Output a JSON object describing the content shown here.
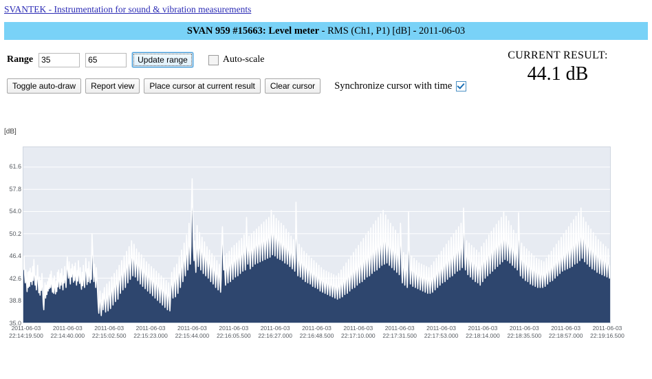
{
  "site": {
    "link_text": "SVANTEK - Instrumentation for sound & vibration measurements"
  },
  "title_banner": {
    "device": "SVAN 959 #15663: Level meter",
    "rest": " - RMS (Ch1, P1) [dB] - 2011-06-03"
  },
  "controls": {
    "range_label": "Range",
    "range_min": "35",
    "range_max": "65",
    "update_range_label": "Update range",
    "autoscale_label": "Auto-scale",
    "autoscale_checked": false,
    "toggle_autodraw_label": "Toggle auto-draw",
    "report_view_label": "Report view",
    "place_cursor_label": "Place cursor at current result",
    "clear_cursor_label": "Clear cursor",
    "sync_cursor_label": "Synchronize cursor with time",
    "sync_cursor_checked": true
  },
  "current_result": {
    "label": "CURRENT RESULT:",
    "value": "44.1 dB"
  },
  "colors": {
    "banner": "#79d2f7",
    "link": "#2b2bb5",
    "plot_background": "#e7ebf2",
    "gridline": "#ffffff",
    "series_fill": "#2e466e",
    "series_line": "#ffffff"
  },
  "chart_data": {
    "type": "area",
    "title": "SVAN 959 #15663: Level meter - RMS (Ch1, P1) [dB] - 2011-06-03",
    "xlabel": "",
    "ylabel": "[dB]",
    "unit": "[dB]",
    "grid": true,
    "legend": "none",
    "ylim": [
      35.0,
      65.0
    ],
    "yticks": [
      61.6,
      57.8,
      54.0,
      50.2,
      46.4,
      42.6,
      38.8,
      35.0
    ],
    "ytick_labels": [
      "61.6",
      "57.8",
      "54.0",
      "50.2",
      "46.4",
      "42.6",
      "38.8",
      "35.0"
    ],
    "xtick_labels": [
      [
        "2011-06-03",
        "22:14:19.500"
      ],
      [
        "2011-06-03",
        "22:14:40.000"
      ],
      [
        "2011-06-03",
        "22:15:02.500"
      ],
      [
        "2011-06-03",
        "22:15:23.000"
      ],
      [
        "2011-06-03",
        "22:15:44.000"
      ],
      [
        "2011-06-03",
        "22:16:05.500"
      ],
      [
        "2011-06-03",
        "22:16:27.000"
      ],
      [
        "2011-06-03",
        "22:16:48.500"
      ],
      [
        "2011-06-03",
        "22:17:10.000"
      ],
      [
        "2011-06-03",
        "22:17:31.500"
      ],
      [
        "2011-06-03",
        "22:17:53.000"
      ],
      [
        "2011-06-03",
        "22:18:14.000"
      ],
      [
        "2011-06-03",
        "22:18:35.500"
      ],
      [
        "2011-06-03",
        "22:18:57.000"
      ],
      [
        "2011-06-03",
        "22:19:16.500"
      ]
    ],
    "series": [
      {
        "name": "RMS (Ch1, P1) [dB]",
        "values": [
          44.0,
          46.3,
          43.2,
          41.8,
          44.0,
          42.0,
          40.3,
          43.6,
          41.0,
          43.8,
          41.2,
          44.3,
          42.0,
          43.5,
          41.5,
          44.6,
          42.2,
          45.8,
          43.1,
          41.4,
          43.0,
          40.6,
          42.4,
          44.8,
          41.9,
          40.1,
          42.8,
          39.7,
          42.2,
          40.5,
          43.4,
          41.0,
          38.4,
          37.2,
          39.6,
          41.8,
          39.2,
          41.4,
          39.8,
          42.0,
          40.4,
          42.6,
          40.8,
          43.2,
          41.0,
          43.8,
          41.6,
          40.2,
          42.4,
          40.0,
          43.0,
          41.2,
          39.9,
          42.1,
          40.3,
          43.6,
          41.1,
          44.0,
          42.2,
          40.8,
          43.4,
          41.4,
          44.2,
          42.0,
          40.6,
          43.0,
          41.8,
          44.6,
          42.4,
          41.0,
          43.8,
          46.2,
          44.0,
          42.6,
          45.4,
          43.0,
          41.6,
          44.2,
          42.8,
          45.0,
          43.4,
          41.9,
          44.6,
          42.2,
          45.2,
          43.0,
          41.4,
          43.9,
          42.1,
          45.6,
          43.2,
          41.7,
          44.4,
          42.0,
          40.7,
          43.6,
          41.3,
          44.8,
          42.5,
          41.0,
          43.2,
          46.0,
          43.8,
          41.5,
          44.2,
          42.0,
          45.4,
          43.1,
          41.8,
          44.0,
          42.4,
          50.2,
          47.6,
          44.2,
          42.0,
          45.0,
          43.2,
          41.0,
          44.4,
          42.6,
          40.2,
          38.0,
          36.6,
          38.8,
          40.4,
          37.6,
          36.2,
          38.4,
          40.0,
          37.2,
          39.4,
          41.0,
          38.2,
          36.8,
          39.0,
          41.6,
          38.8,
          37.0,
          39.8,
          42.0,
          39.2,
          37.4,
          40.0,
          42.8,
          40.2,
          38.0,
          41.0,
          43.4,
          40.6,
          38.6,
          41.4,
          44.0,
          41.2,
          39.0,
          42.0,
          44.8,
          42.2,
          40.0,
          43.0,
          45.6,
          42.8,
          40.6,
          43.6,
          46.4,
          43.2,
          41.0,
          44.0,
          47.2,
          44.2,
          41.8,
          44.6,
          48.0,
          45.0,
          42.4,
          45.4,
          49.0,
          46.0,
          43.0,
          45.8,
          48.4,
          45.2,
          42.8,
          45.0,
          47.6,
          44.6,
          42.2,
          44.8,
          47.0,
          44.0,
          41.6,
          44.2,
          46.6,
          43.8,
          41.2,
          43.6,
          46.0,
          43.0,
          40.8,
          43.2,
          45.4,
          42.6,
          40.4,
          42.8,
          45.0,
          42.2,
          40.0,
          42.4,
          44.6,
          41.8,
          39.6,
          42.0,
          44.2,
          41.4,
          39.2,
          41.6,
          43.8,
          41.0,
          38.8,
          41.2,
          43.4,
          40.6,
          38.4,
          40.8,
          43.0,
          40.2,
          38.0,
          40.4,
          42.6,
          39.8,
          37.6,
          40.0,
          42.2,
          39.4,
          37.2,
          39.6,
          41.8,
          39.0,
          37.0,
          39.2,
          41.4,
          43.6,
          41.0,
          39.2,
          42.0,
          44.4,
          41.6,
          39.4,
          42.4,
          45.0,
          42.0,
          40.0,
          43.0,
          46.2,
          43.4,
          41.0,
          44.0,
          47.4,
          44.4,
          42.0,
          45.0,
          48.6,
          45.4,
          43.0,
          46.0,
          50.0,
          46.6,
          44.0,
          47.0,
          52.0,
          48.0,
          45.0,
          48.0,
          55.0,
          59.6,
          53.0,
          48.0,
          45.6,
          49.0,
          46.0,
          43.6,
          47.0,
          51.6,
          47.4,
          44.6,
          48.0,
          50.4,
          46.8,
          44.0,
          47.2,
          49.6,
          46.2,
          43.4,
          46.4,
          48.8,
          45.6,
          43.0,
          45.8,
          48.0,
          45.0,
          42.6,
          45.2,
          47.4,
          44.4,
          42.0,
          44.6,
          46.8,
          43.8,
          41.6,
          44.0,
          46.2,
          43.2,
          41.0,
          43.4,
          45.6,
          42.6,
          40.6,
          43.0,
          45.0,
          42.0,
          40.2,
          42.6,
          49.0,
          51.4,
          47.0,
          44.0,
          46.4,
          43.4,
          41.4,
          44.2,
          46.8,
          43.8,
          41.8,
          44.6,
          47.2,
          44.2,
          42.0,
          45.0,
          47.8,
          44.6,
          42.4,
          45.4,
          48.2,
          45.0,
          42.8,
          45.8,
          48.6,
          45.4,
          43.0,
          46.0,
          49.0,
          45.8,
          43.4,
          46.4,
          49.4,
          46.2,
          43.8,
          46.8,
          50.0,
          46.6,
          44.0,
          47.0,
          53.0,
          48.0,
          45.0,
          47.4,
          49.8,
          46.4,
          44.2,
          47.2,
          50.2,
          47.0,
          44.6,
          47.6,
          50.6,
          47.4,
          45.0,
          48.0,
          51.0,
          47.8,
          45.2,
          48.2,
          51.4,
          48.0,
          45.4,
          48.4,
          51.8,
          48.2,
          45.6,
          48.6,
          52.2,
          48.4,
          45.8,
          48.8,
          52.6,
          48.6,
          46.0,
          49.0,
          53.0,
          49.2,
          46.2,
          49.4,
          54.2,
          50.0,
          46.6,
          49.8,
          53.4,
          49.6,
          46.4,
          49.2,
          52.8,
          49.0,
          46.0,
          48.8,
          52.4,
          48.6,
          45.8,
          48.4,
          52.0,
          48.2,
          45.6,
          48.0,
          51.6,
          47.8,
          45.2,
          47.6,
          51.0,
          47.4,
          45.0,
          47.2,
          50.4,
          47.0,
          44.6,
          46.8,
          49.8,
          46.4,
          44.2,
          46.4,
          49.2,
          46.0,
          43.8,
          46.0,
          55.6,
          50.0,
          45.4,
          43.0,
          45.6,
          48.4,
          45.0,
          42.8,
          45.2,
          47.8,
          44.6,
          42.4,
          44.8,
          47.2,
          44.2,
          42.0,
          44.4,
          46.8,
          43.8,
          41.8,
          44.0,
          46.4,
          43.4,
          41.6,
          43.6,
          46.0,
          43.0,
          41.2,
          43.2,
          45.6,
          42.8,
          41.0,
          43.0,
          45.2,
          42.4,
          40.8,
          42.6,
          44.8,
          42.0,
          40.4,
          42.2,
          44.4,
          41.8,
          40.2,
          42.0,
          44.0,
          41.4,
          40.0,
          41.8,
          43.8,
          41.2,
          39.8,
          41.6,
          43.6,
          41.0,
          39.6,
          41.4,
          43.4,
          41.0,
          39.4,
          41.2,
          43.2,
          40.8,
          39.2,
          41.0,
          43.0,
          40.6,
          39.0,
          41.0,
          43.4,
          40.8,
          39.2,
          41.4,
          44.0,
          41.2,
          39.4,
          41.8,
          44.6,
          41.6,
          39.8,
          42.2,
          45.2,
          42.0,
          40.0,
          42.6,
          45.8,
          42.4,
          40.4,
          43.0,
          46.4,
          42.8,
          40.8,
          43.4,
          47.0,
          43.2,
          41.0,
          43.8,
          47.6,
          43.6,
          41.4,
          44.2,
          48.2,
          44.0,
          41.8,
          44.6,
          48.8,
          44.4,
          42.0,
          45.0,
          49.4,
          44.8,
          42.4,
          45.4,
          50.0,
          45.2,
          42.8,
          45.8,
          50.6,
          45.6,
          43.0,
          46.2,
          51.2,
          46.0,
          43.4,
          46.6,
          51.8,
          46.4,
          43.8,
          47.0,
          52.4,
          46.8,
          44.0,
          47.4,
          53.0,
          47.2,
          44.4,
          47.8,
          53.6,
          47.6,
          44.8,
          48.2,
          54.2,
          48.0,
          45.0,
          48.6,
          53.4,
          47.8,
          45.2,
          48.0,
          52.6,
          47.4,
          44.8,
          47.6,
          52.0,
          47.0,
          44.4,
          47.2,
          51.4,
          46.6,
          44.0,
          46.8,
          50.8,
          46.2,
          43.6,
          46.4,
          50.2,
          45.8,
          43.2,
          46.0,
          52.0,
          49.0,
          44.0,
          41.8,
          44.4,
          47.0,
          43.8,
          41.4,
          44.0,
          46.6,
          43.4,
          41.0,
          43.6,
          54.0,
          48.0,
          44.2,
          41.6,
          44.0,
          46.4,
          43.2,
          41.2,
          43.8,
          46.0,
          43.0,
          41.0,
          43.4,
          45.6,
          42.6,
          40.8,
          43.0,
          45.2,
          42.4,
          40.6,
          42.8,
          45.0,
          42.2,
          40.4,
          42.6,
          44.8,
          42.0,
          40.2,
          42.4,
          44.6,
          41.8,
          40.0,
          42.2,
          44.4,
          41.6,
          40.0,
          42.0,
          44.8,
          42.0,
          40.2,
          42.6,
          45.4,
          42.4,
          40.6,
          43.0,
          46.0,
          43.0,
          41.0,
          43.6,
          46.6,
          43.4,
          41.4,
          44.0,
          47.2,
          43.8,
          41.8,
          44.4,
          47.8,
          44.2,
          42.0,
          45.0,
          48.4,
          44.6,
          42.4,
          45.4,
          49.0,
          45.0,
          42.8,
          45.8,
          49.6,
          45.4,
          43.0,
          46.2,
          50.2,
          46.0,
          43.4,
          46.6,
          50.8,
          46.4,
          43.8,
          47.0,
          51.4,
          46.8,
          44.0,
          47.4,
          52.0,
          47.2,
          44.4,
          47.8,
          54.6,
          51.0,
          46.0,
          44.0,
          46.4,
          49.0,
          45.4,
          43.2,
          46.0,
          48.6,
          45.0,
          42.8,
          45.6,
          48.2,
          44.6,
          42.4,
          45.2,
          47.8,
          44.2,
          42.0,
          44.8,
          47.4,
          43.8,
          41.8,
          44.4,
          47.0,
          43.4,
          41.4,
          44.0,
          48.0,
          45.0,
          42.0,
          44.6,
          48.6,
          45.4,
          42.6,
          45.0,
          49.2,
          45.8,
          43.0,
          45.6,
          50.0,
          46.4,
          43.4,
          46.0,
          50.6,
          47.0,
          43.8,
          46.6,
          51.2,
          47.4,
          44.2,
          47.0,
          51.8,
          47.8,
          44.6,
          47.4,
          52.4,
          48.2,
          45.0,
          47.8,
          53.0,
          48.6,
          45.4,
          48.2,
          54.0,
          49.0,
          45.8,
          48.6,
          53.2,
          48.4,
          45.6,
          48.0,
          52.4,
          48.0,
          45.2,
          47.6,
          51.6,
          47.4,
          44.8,
          47.0,
          50.8,
          47.0,
          44.4,
          46.6,
          50.2,
          46.4,
          44.0,
          46.2,
          53.8,
          50.0,
          45.4,
          43.0,
          45.8,
          48.6,
          45.0,
          42.6,
          45.4,
          48.0,
          44.6,
          42.2,
          45.0,
          47.6,
          44.2,
          42.0,
          44.6,
          47.2,
          43.8,
          41.6,
          44.2,
          46.8,
          43.4,
          41.4,
          44.0,
          46.4,
          43.2,
          41.2,
          43.6,
          46.0,
          43.0,
          41.0,
          43.4,
          45.8,
          42.8,
          41.0,
          43.2,
          45.6,
          42.6,
          41.0,
          43.0,
          45.4,
          42.8,
          41.2,
          43.4,
          46.0,
          43.2,
          41.6,
          43.8,
          46.6,
          43.6,
          42.0,
          44.2,
          47.2,
          44.0,
          42.2,
          44.6,
          47.8,
          44.4,
          42.6,
          45.0,
          48.4,
          44.8,
          43.0,
          45.4,
          49.0,
          45.2,
          43.4,
          45.8,
          49.6,
          45.6,
          43.8,
          46.2,
          50.2,
          46.0,
          44.0,
          46.6,
          50.8,
          46.4,
          44.2,
          47.0,
          51.4,
          46.8,
          44.4,
          47.4,
          52.0,
          47.2,
          44.6,
          47.8,
          52.6,
          47.6,
          45.0,
          48.2,
          53.2,
          48.0,
          45.2,
          48.6,
          53.8,
          48.4,
          45.6,
          49.0,
          54.6,
          49.0,
          46.0,
          49.4,
          53.0,
          48.2,
          45.4,
          48.4,
          52.2,
          47.8,
          45.0,
          48.0,
          51.6,
          47.2,
          44.6,
          47.4,
          51.0,
          46.8,
          44.2,
          47.0,
          50.4,
          46.4,
          44.0,
          46.6,
          49.8,
          46.0,
          43.6,
          46.2,
          49.2,
          45.6,
          43.4,
          46.0,
          48.8,
          45.2,
          43.2,
          45.6,
          48.4,
          45.0,
          43.0,
          45.4,
          48.0,
          44.6,
          42.8,
          45.0,
          47.6,
          44.4,
          42.6,
          44.8
        ]
      }
    ]
  }
}
